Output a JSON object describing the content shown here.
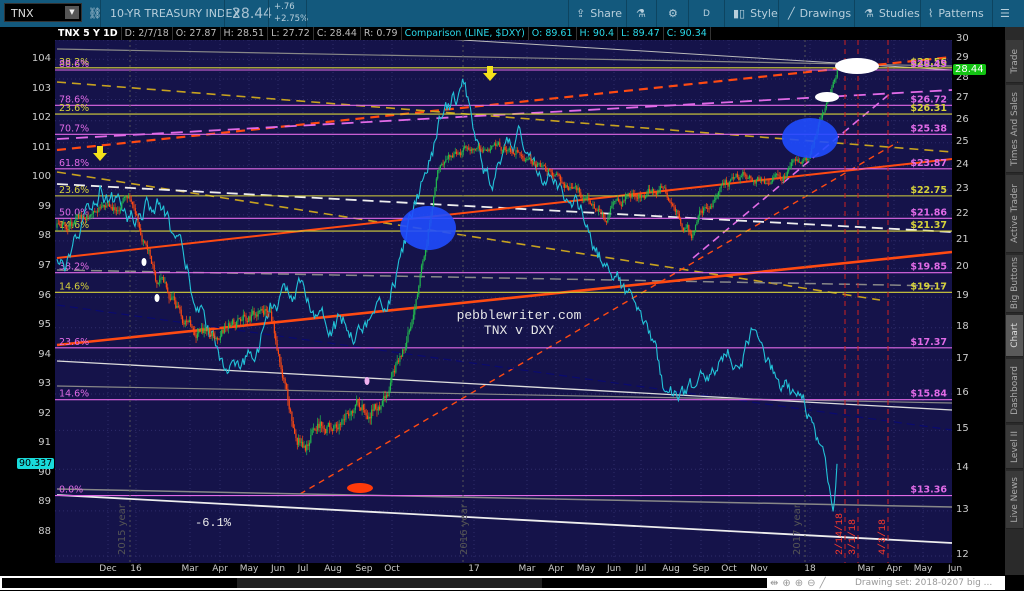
{
  "toolbar": {
    "symbol": "TNX",
    "description": "10-YR TREASURY INDEX",
    "last": "28.44",
    "change": "+.76",
    "change_pct": "+2.75%",
    "share": "Share",
    "aggregation": "D",
    "style": "Style",
    "drawings": "Drawings",
    "studies": "Studies",
    "patterns": "Patterns"
  },
  "info": {
    "title": "TNX 5 Y 1D",
    "date": "D: 2/7/18",
    "open": "O: 27.87",
    "high": "H: 28.51",
    "low": "L: 27.72",
    "close": "C: 28.44",
    "range": "R: 0.79",
    "comparison": "Comparison (LINE, $DXY)",
    "cmp_open": "O: 89.61",
    "cmp_high": "H: 90.4",
    "cmp_low": "L: 89.47",
    "cmp_close": "C: 90.34"
  },
  "sidebar": [
    "Trade",
    "Times And Sales",
    "Active Trader",
    "Big Buttons",
    "Chart",
    "Dashboard",
    "Level II",
    "Live News"
  ],
  "bottom": {
    "drawing_set": "Drawing set: 2018-0207 big ..."
  },
  "annotations": {
    "watermark": "pebblewriter.com",
    "subtitle": "TNX v DXY",
    "pct_change": "-6.1%",
    "year_labels": [
      "2015 year",
      "2016 year",
      "2017 year"
    ],
    "date_markers": [
      "2/14/18",
      "3/1/18",
      "4/3/18"
    ]
  },
  "colors": {
    "background": "#15134a",
    "up": "#22b94f",
    "down": "#ff4a12",
    "dxy": "#22c3d8",
    "fib_pink": "#e06ae6",
    "fib_yellow": "#d6d23a",
    "price_badge": "#13c313",
    "dxy_badge": "#19dada"
  },
  "chart_data": {
    "type": "candlestick+line",
    "title": "TNX 5 Y 1D vs $DXY",
    "x_tick_labels": [
      "Dec",
      "16",
      "Mar",
      "Apr",
      "May",
      "Jun",
      "Jul",
      "Aug",
      "Sep",
      "Oct",
      "17",
      "Mar",
      "Apr",
      "May",
      "Jun",
      "Jul",
      "Aug",
      "Sep",
      "Oct",
      "Nov",
      "18",
      "Mar",
      "Apr",
      "May",
      "Jun"
    ],
    "right_axis": {
      "label": "TNX",
      "ticks": [
        12,
        13,
        14,
        15,
        16,
        17,
        18,
        19,
        20,
        21,
        22,
        23,
        24,
        25,
        26,
        27,
        28,
        29,
        30
      ],
      "scale": "log",
      "range": [
        12,
        30
      ],
      "last": "28.44"
    },
    "left_axis": {
      "label": "DXY",
      "ticks": [
        88,
        89,
        90,
        91,
        92,
        93,
        94,
        95,
        96,
        97,
        98,
        99,
        100,
        101,
        102,
        103,
        104
      ],
      "range": [
        87.3,
        105.3
      ],
      "last": "90.337"
    },
    "months": [
      "2015-11",
      "2015-12",
      "2016-01",
      "2016-02",
      "2016-03",
      "2016-04",
      "2016-05",
      "2016-06",
      "2016-07",
      "2016-08",
      "2016-09",
      "2016-10",
      "2016-11",
      "2016-12",
      "2017-01",
      "2017-02",
      "2017-03",
      "2017-04",
      "2017-05",
      "2017-06",
      "2017-07",
      "2017-08",
      "2017-09",
      "2017-10",
      "2017-11",
      "2017-12",
      "2018-01",
      "2018-02"
    ],
    "tnx_monthly": [
      21.5,
      22.2,
      22.7,
      19.5,
      18.2,
      17.8,
      18.3,
      18.5,
      14.5,
      15.2,
      15.8,
      16.0,
      18.3,
      23.8,
      24.5,
      24.5,
      24.8,
      23.9,
      22.8,
      22.0,
      23.0,
      22.9,
      21.2,
      23.3,
      23.7,
      23.6,
      24.1,
      27.9
    ],
    "tnx_last": 28.44,
    "dxy_monthly": [
      97.0,
      99.8,
      98.7,
      99.2,
      97.0,
      94.6,
      93.0,
      95.5,
      96.2,
      95.5,
      95.0,
      95.5,
      98.5,
      101.5,
      103.0,
      99.8,
      101.3,
      100.2,
      99.0,
      97.0,
      95.8,
      93.0,
      92.5,
      93.5,
      94.7,
      93.2,
      92.2,
      89.2
    ],
    "dxy_last": 90.34,
    "fib_levels": [
      {
        "pct": "38.2%",
        "price": "$28.56",
        "value": 28.56,
        "color": "yellow"
      },
      {
        "pct": "88.6%",
        "price": "$28.45",
        "value": 28.45,
        "color": "pink"
      },
      {
        "pct": "78.6%",
        "price": "$26.72",
        "value": 26.72,
        "color": "pink"
      },
      {
        "pct": "23.6%",
        "price": "$26.31",
        "value": 26.31,
        "color": "yellow"
      },
      {
        "pct": "70.7%",
        "price": "$25.38",
        "value": 25.38,
        "color": "pink"
      },
      {
        "pct": "61.8%",
        "price": "$23.87",
        "value": 23.87,
        "color": "pink"
      },
      {
        "pct": "23.6%",
        "price": "$22.75",
        "value": 22.75,
        "color": "yellow"
      },
      {
        "pct": "50.0%",
        "price": "$21.86",
        "value": 21.86,
        "color": "pink"
      },
      {
        "pct": "14.6%",
        "price": "$21.37",
        "value": 21.37,
        "color": "yellow"
      },
      {
        "pct": "38.2%",
        "price": "$19.85",
        "value": 19.85,
        "color": "pink"
      },
      {
        "pct": "14.6%",
        "price": "$19.17",
        "value": 19.17,
        "color": "yellow"
      },
      {
        "pct": "23.6%",
        "price": "$17.37",
        "value": 17.37,
        "color": "pink"
      },
      {
        "pct": "14.6%",
        "price": "$15.84",
        "value": 15.84,
        "color": "pink"
      },
      {
        "pct": "0.0%",
        "price": "$13.36",
        "value": 13.36,
        "color": "pink"
      }
    ]
  }
}
